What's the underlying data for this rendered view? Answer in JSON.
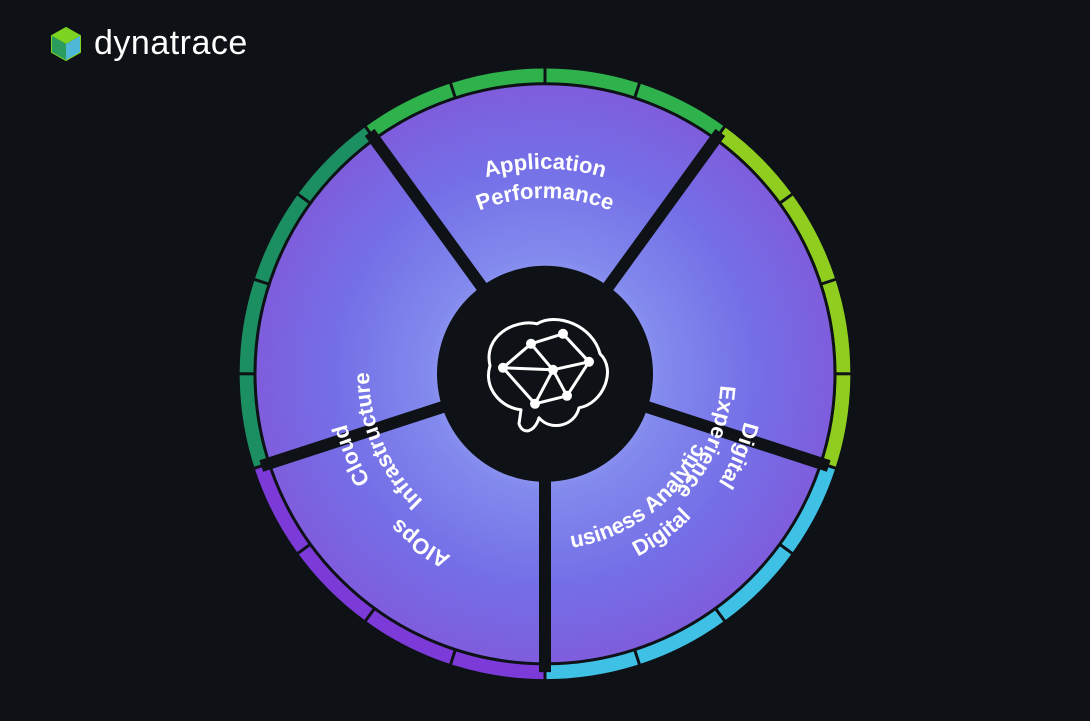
{
  "brand": {
    "name": "dynatrace"
  },
  "center": {
    "icon": "brain-network-icon"
  },
  "segments": [
    {
      "id": "application-performance",
      "line1": "Application",
      "line2": "Performance",
      "rim_color": "#2fb24c"
    },
    {
      "id": "digital-experience",
      "line1": "Digital",
      "line2": "Experience",
      "rim_color": "#8fce1f"
    },
    {
      "id": "digital-business-analytics",
      "line1": "Digital",
      "line2": "Business Analytics",
      "rim_color": "#3fc0e5"
    },
    {
      "id": "aiops",
      "line1": "AIOps",
      "line2": "",
      "rim_color": "#7c3bd8"
    },
    {
      "id": "cloud-infrastructure",
      "line1": "Cloud",
      "line2": "Infrastructure",
      "rim_color": "#1b8f62"
    }
  ],
  "colors": {
    "bg": "#0e1217",
    "segment_gradient_start": "#5f7cf0",
    "segment_gradient_end": "#8a54d6",
    "center_bg": "#0e1217",
    "divider": "#0e1217"
  },
  "chart_data": {
    "type": "pie",
    "title": "",
    "categories": [
      "Application Performance",
      "Digital Experience",
      "Digital Business Analytics",
      "AIOps",
      "Cloud Infrastructure"
    ],
    "values": [
      1,
      1,
      1,
      1,
      1
    ]
  }
}
